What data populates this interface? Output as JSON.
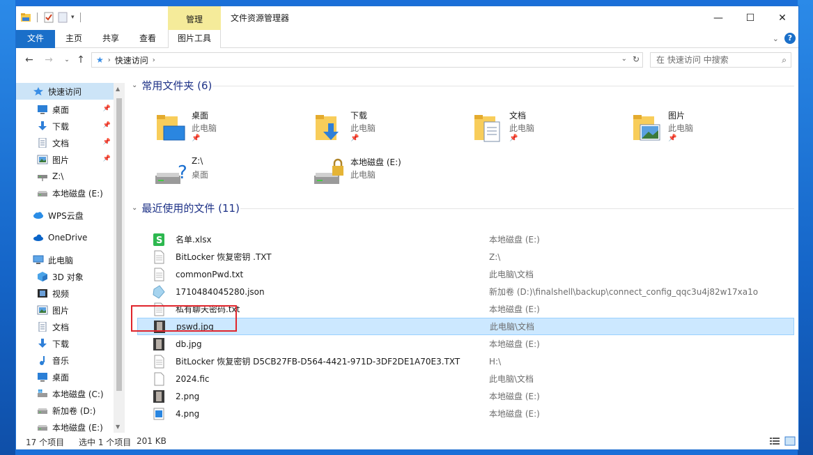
{
  "window": {
    "title": "文件资源管理器",
    "context_tab": "管理",
    "controls": {
      "minimize": "—",
      "maximize": "☐",
      "close": "✕"
    }
  },
  "ribbon": {
    "tabs": [
      "文件",
      "主页",
      "共享",
      "查看",
      "图片工具"
    ],
    "help": "?"
  },
  "address": {
    "crumb": "快速访问",
    "search_placeholder": "在 快速访问 中搜索"
  },
  "sidebar": {
    "items": [
      {
        "label": "快速访问",
        "icon": "star-icon",
        "indent": 0,
        "pinned": false,
        "selected": true
      },
      {
        "label": "桌面",
        "icon": "desktop-icon",
        "indent": 1,
        "pinned": true
      },
      {
        "label": "下载",
        "icon": "download-icon",
        "indent": 1,
        "pinned": true
      },
      {
        "label": "文档",
        "icon": "documents-icon",
        "indent": 1,
        "pinned": true
      },
      {
        "label": "图片",
        "icon": "pictures-icon",
        "indent": 1,
        "pinned": true
      },
      {
        "label": "Z:\\",
        "icon": "network-drive-icon",
        "indent": 1,
        "pinned": false
      },
      {
        "label": "本地磁盘 (E:)",
        "icon": "drive-icon",
        "indent": 1,
        "pinned": false
      },
      {
        "label": "WPS云盘",
        "icon": "cloud-icon",
        "indent": 0,
        "pinned": false
      },
      {
        "label": "OneDrive",
        "icon": "onedrive-icon",
        "indent": 0,
        "pinned": false
      },
      {
        "label": "此电脑",
        "icon": "computer-icon",
        "indent": 0,
        "pinned": false
      },
      {
        "label": "3D 对象",
        "icon": "cube-icon",
        "indent": 1,
        "pinned": false
      },
      {
        "label": "视频",
        "icon": "video-icon",
        "indent": 1,
        "pinned": false
      },
      {
        "label": "图片",
        "icon": "pictures-icon",
        "indent": 1,
        "pinned": false
      },
      {
        "label": "文档",
        "icon": "documents-icon",
        "indent": 1,
        "pinned": false
      },
      {
        "label": "下载",
        "icon": "download-icon",
        "indent": 1,
        "pinned": false
      },
      {
        "label": "音乐",
        "icon": "music-icon",
        "indent": 1,
        "pinned": false
      },
      {
        "label": "桌面",
        "icon": "desktop-icon",
        "indent": 1,
        "pinned": false
      },
      {
        "label": "本地磁盘 (C:)",
        "icon": "windows-drive-icon",
        "indent": 1,
        "pinned": false
      },
      {
        "label": "新加卷 (D:)",
        "icon": "drive-icon",
        "indent": 1,
        "pinned": false
      },
      {
        "label": "本地磁盘 (E:)",
        "icon": "drive-icon",
        "indent": 1,
        "pinned": false
      }
    ]
  },
  "frequent": {
    "header": "常用文件夹 (6)",
    "tiles": [
      {
        "name": "桌面",
        "sub": "此电脑",
        "icon": "desktop-folder-icon",
        "pinned": true
      },
      {
        "name": "下载",
        "sub": "此电脑",
        "icon": "download-folder-icon",
        "pinned": true
      },
      {
        "name": "文档",
        "sub": "此电脑",
        "icon": "documents-folder-icon",
        "pinned": true
      },
      {
        "name": "图片",
        "sub": "此电脑",
        "icon": "pictures-folder-icon",
        "pinned": true
      },
      {
        "name": "Z:\\",
        "sub": "桌面",
        "icon": "unknown-drive-icon",
        "pinned": false
      },
      {
        "name": "本地磁盘 (E:)",
        "sub": "此电脑",
        "icon": "locked-drive-icon",
        "pinned": false
      }
    ]
  },
  "recent": {
    "header": "最近使用的文件 (11)",
    "files": [
      {
        "name": "名单.xlsx",
        "path": "本地磁盘 (E:)",
        "icon": "spreadsheet-icon"
      },
      {
        "name": "BitLocker 恢复密钥 .TXT",
        "path": "Z:\\",
        "icon": "text-file-icon"
      },
      {
        "name": "commonPwd.txt",
        "path": "此电脑\\文档",
        "icon": "text-file-icon"
      },
      {
        "name": "1710484045280.json",
        "path": "新加卷 (D:)\\finalshell\\backup\\connect_config_qqc3u4j82w17xa1o",
        "icon": "json-file-icon"
      },
      {
        "name": "私有聊天密码.txt",
        "path": "本地磁盘 (E:)",
        "icon": "text-file-icon"
      },
      {
        "name": "pswd.jpg",
        "path": "此电脑\\文档",
        "icon": "image-thumb-icon",
        "selected": true
      },
      {
        "name": "db.jpg",
        "path": "本地磁盘 (E:)",
        "icon": "image-thumb-icon"
      },
      {
        "name": "BitLocker 恢复密钥 D5CB27FB-D564-4421-971D-3DF2DE1A70E3.TXT",
        "path": "H:\\",
        "icon": "text-file-icon"
      },
      {
        "name": "2024.fic",
        "path": "此电脑\\文档",
        "icon": "blank-file-icon"
      },
      {
        "name": "2.png",
        "path": "本地磁盘 (E:)",
        "icon": "image-thumb-icon"
      },
      {
        "name": "4.png",
        "path": "本地磁盘 (E:)",
        "icon": "png-file-icon"
      }
    ]
  },
  "status": {
    "count": "17 个项目",
    "selection": "选中 1 个项目",
    "size": "201 KB"
  }
}
